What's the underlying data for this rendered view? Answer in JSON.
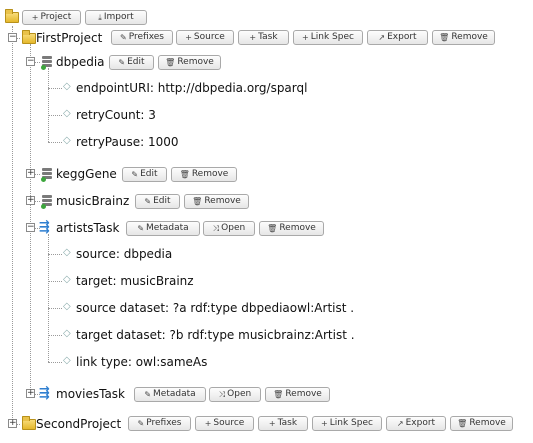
{
  "toolbar": {
    "project_label": "Project",
    "import_label": "Import"
  },
  "icons": {
    "add": "+",
    "import": "⤓",
    "prefixes": "✎",
    "edit": "✎",
    "remove": "🗑",
    "export": "↗",
    "linkspec": "⤓",
    "metadata": "✎",
    "open": "⤨",
    "expand": "+",
    "collapse": "−",
    "tag": "◇"
  },
  "colors": {
    "folder": "#e5b82c",
    "task": "#2f7fd0",
    "datasource": "#3ca63c"
  },
  "projects": [
    {
      "name": "FirstProject",
      "buttons": {
        "prefixes": "Prefixes",
        "source": "Source",
        "task": "Task",
        "linkspec": "Link Spec",
        "export": "Export",
        "remove": "Remove"
      },
      "sources": [
        {
          "name": "dbpedia",
          "edit": "Edit",
          "remove": "Remove",
          "props": [
            "endpointURI: http://dbpedia.org/sparql",
            "retryCount: 3",
            "retryPause: 1000"
          ]
        },
        {
          "name": "keggGene",
          "edit": "Edit",
          "remove": "Remove"
        },
        {
          "name": "musicBrainz",
          "edit": "Edit",
          "remove": "Remove"
        }
      ],
      "tasks": [
        {
          "name": "artistsTask",
          "metadata": "Metadata",
          "open": "Open",
          "remove": "Remove",
          "props": [
            "source: dbpedia",
            "target: musicBrainz",
            "source dataset: ?a rdf:type dbpediaowl:Artist .",
            "target dataset: ?b rdf:type musicbrainz:Artist .",
            "link type: owl:sameAs"
          ]
        },
        {
          "name": "moviesTask",
          "metadata": "Metadata",
          "open": "Open",
          "remove": "Remove"
        }
      ]
    },
    {
      "name": "SecondProject",
      "buttons": {
        "prefixes": "Prefixes",
        "source": "Source",
        "task": "Task",
        "linkspec": "Link Spec",
        "export": "Export",
        "remove": "Remove"
      }
    }
  ]
}
